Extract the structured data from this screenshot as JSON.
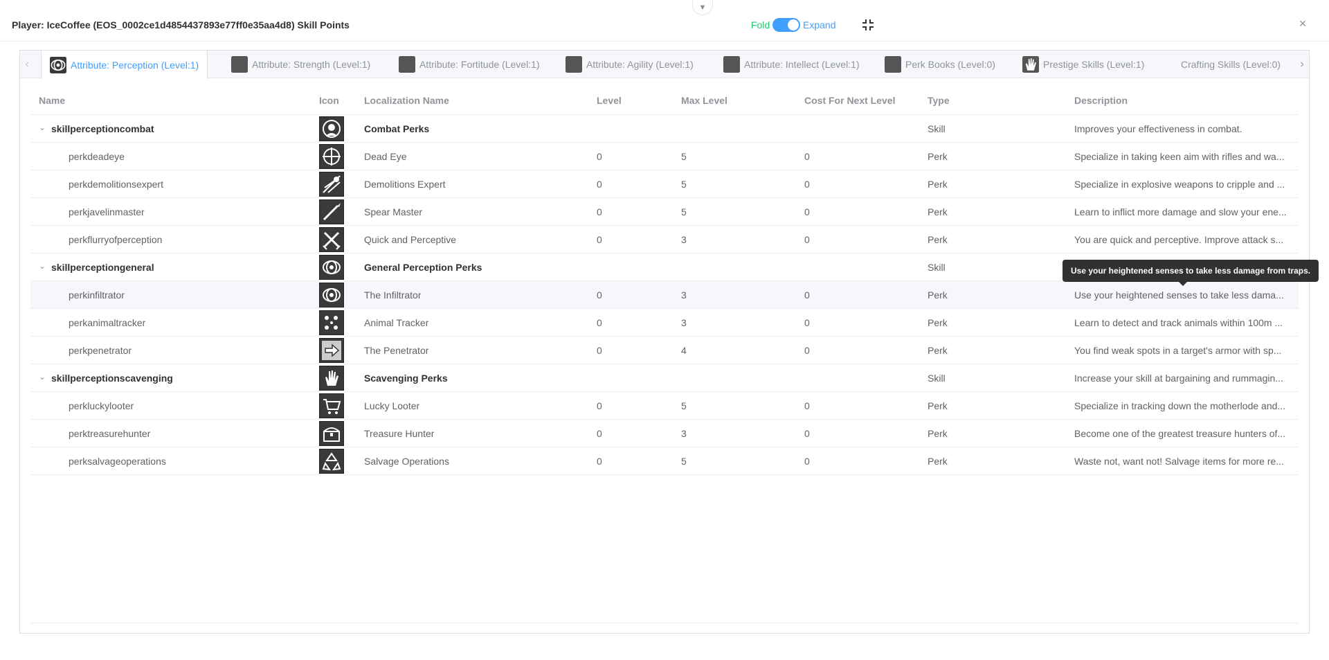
{
  "header": {
    "title": "Player: IceCoffee (EOS_0002ce1d4854437893e77ff0e35aa4d8) Skill Points",
    "fold_label": "Fold",
    "expand_label": "Expand",
    "toggle_state": "expand",
    "accent_color": "#409eff",
    "fold_color": "#13ce66"
  },
  "tabs": [
    {
      "label": "Attribute: Perception (Level:1)",
      "icon": "eye-icon",
      "active": true
    },
    {
      "label": "Attribute: Strength (Level:1)",
      "icon": "strength-icon",
      "active": false
    },
    {
      "label": "Attribute: Fortitude (Level:1)",
      "icon": "fortitude-icon",
      "active": false
    },
    {
      "label": "Attribute: Agility (Level:1)",
      "icon": "agility-icon",
      "active": false
    },
    {
      "label": "Attribute: Intellect (Level:1)",
      "icon": "intellect-icon",
      "active": false
    },
    {
      "label": "Perk Books (Level:0)",
      "icon": "book-icon",
      "active": false
    },
    {
      "label": "Prestige Skills (Level:1)",
      "icon": "hand-icon",
      "active": false
    },
    {
      "label": "Crafting Skills (Level:0)",
      "icon": "",
      "active": false
    }
  ],
  "table": {
    "columns": [
      "Name",
      "Icon",
      "Localization Name",
      "Level",
      "Max Level",
      "Cost For Next Level",
      "Type",
      "Description"
    ],
    "rows": [
      {
        "kind": "skill",
        "name": "skillperceptioncombat",
        "icon": "combat-portrait-icon",
        "loc": "Combat Perks",
        "level": "",
        "max": "",
        "cost": "",
        "type": "Skill",
        "desc": "Improves your effectiveness in combat."
      },
      {
        "kind": "perk",
        "name": "perkdeadeye",
        "icon": "crosshair-icon",
        "loc": "Dead Eye",
        "level": "0",
        "max": "5",
        "cost": "0",
        "type": "Perk",
        "desc": "Specialize in taking keen aim with rifles and wa..."
      },
      {
        "kind": "perk",
        "name": "perkdemolitionsexpert",
        "icon": "explosion-icon",
        "loc": "Demolitions Expert",
        "level": "0",
        "max": "5",
        "cost": "0",
        "type": "Perk",
        "desc": "Specialize in explosive weapons to cripple and ..."
      },
      {
        "kind": "perk",
        "name": "perkjavelinmaster",
        "icon": "spear-icon",
        "loc": "Spear Master",
        "level": "0",
        "max": "5",
        "cost": "0",
        "type": "Perk",
        "desc": "Learn to inflict more damage and slow your ene..."
      },
      {
        "kind": "perk",
        "name": "perkflurryofperception",
        "icon": "crossed-blades-icon",
        "loc": "Quick and Perceptive",
        "level": "0",
        "max": "3",
        "cost": "0",
        "type": "Perk",
        "desc": "You are quick and perceptive. Improve attack s..."
      },
      {
        "kind": "skill",
        "name": "skillperceptiongeneral",
        "icon": "eye-icon",
        "loc": "General Perception Perks",
        "level": "",
        "max": "",
        "cost": "",
        "type": "Skill",
        "desc": ""
      },
      {
        "kind": "perk",
        "name": "perkinfiltrator",
        "icon": "eye-icon",
        "loc": "The Infiltrator",
        "level": "0",
        "max": "3",
        "cost": "0",
        "type": "Perk",
        "desc": "Use your heightened senses to take less dama..."
      },
      {
        "kind": "perk",
        "name": "perkanimaltracker",
        "icon": "paw-prints-icon",
        "loc": "Animal Tracker",
        "level": "0",
        "max": "3",
        "cost": "0",
        "type": "Perk",
        "desc": "Learn to detect and track animals within 100m ..."
      },
      {
        "kind": "perk",
        "name": "perkpenetrator",
        "icon": "arrow-right-icon",
        "loc": "The Penetrator",
        "level": "0",
        "max": "4",
        "cost": "0",
        "type": "Perk",
        "desc": "You find weak spots in a target's armor with sp..."
      },
      {
        "kind": "skill",
        "name": "skillperceptionscavenging",
        "icon": "hand-icon",
        "loc": "Scavenging Perks",
        "level": "",
        "max": "",
        "cost": "",
        "type": "Skill",
        "desc": "Increase your skill at bargaining and rummagin..."
      },
      {
        "kind": "perk",
        "name": "perkluckylooter",
        "icon": "cart-icon",
        "loc": "Lucky Looter",
        "level": "0",
        "max": "5",
        "cost": "0",
        "type": "Perk",
        "desc": "Specialize in tracking down the motherlode and..."
      },
      {
        "kind": "perk",
        "name": "perktreasurehunter",
        "icon": "treasure-chest-icon",
        "loc": "Treasure Hunter",
        "level": "0",
        "max": "3",
        "cost": "0",
        "type": "Perk",
        "desc": "Become one of the greatest treasure hunters of..."
      },
      {
        "kind": "perk",
        "name": "perksalvageoperations",
        "icon": "recycle-icon",
        "loc": "Salvage Operations",
        "level": "0",
        "max": "5",
        "cost": "0",
        "type": "Perk",
        "desc": "Waste not, want not! Salvage items for more re..."
      }
    ]
  },
  "tooltip": {
    "text": "Use your heightened senses to take less damage from traps."
  }
}
